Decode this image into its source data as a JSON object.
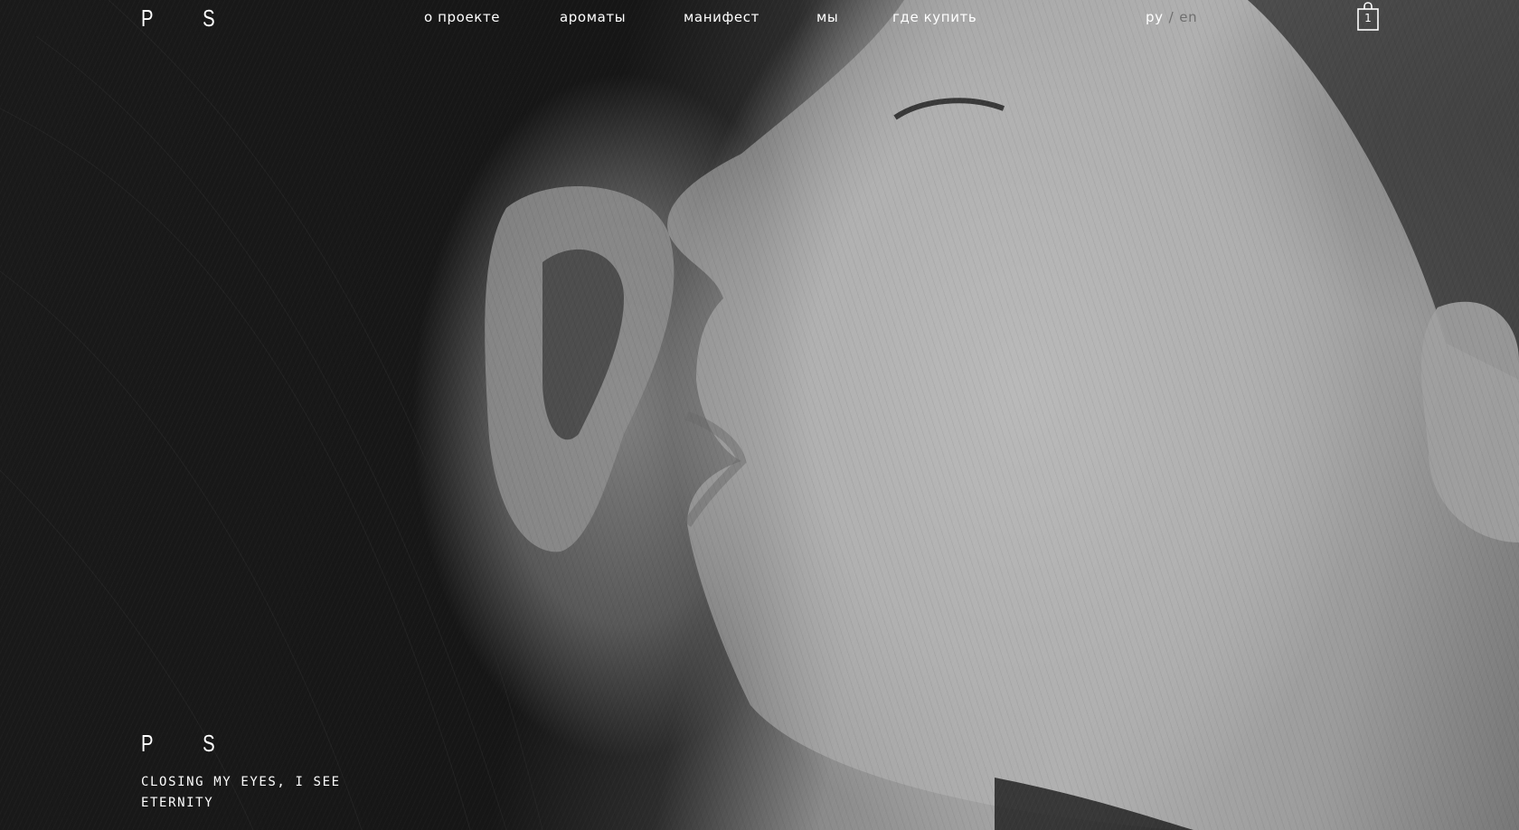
{
  "header": {
    "logo": {
      "letter_1": "P",
      "letter_2": "S"
    },
    "nav": [
      {
        "label": "о проекте"
      },
      {
        "label": "ароматы"
      },
      {
        "label": "манифест"
      },
      {
        "label": "мы"
      },
      {
        "label": "где купить"
      }
    ],
    "language": {
      "active": "ру",
      "separator": "/",
      "inactive": "en"
    },
    "cart": {
      "icon": "shopping-bag-icon",
      "count": "1"
    }
  },
  "hero": {
    "image": "black-and-white close-up portrait in profile",
    "logo": {
      "letter_1": "P",
      "letter_2": "S"
    },
    "tagline": "CLOSING MY EYES, I SEE ETERNITY"
  },
  "colors": {
    "text": "#ffffff",
    "muted": "#6f6f6f",
    "background": "#0b0b0b"
  }
}
